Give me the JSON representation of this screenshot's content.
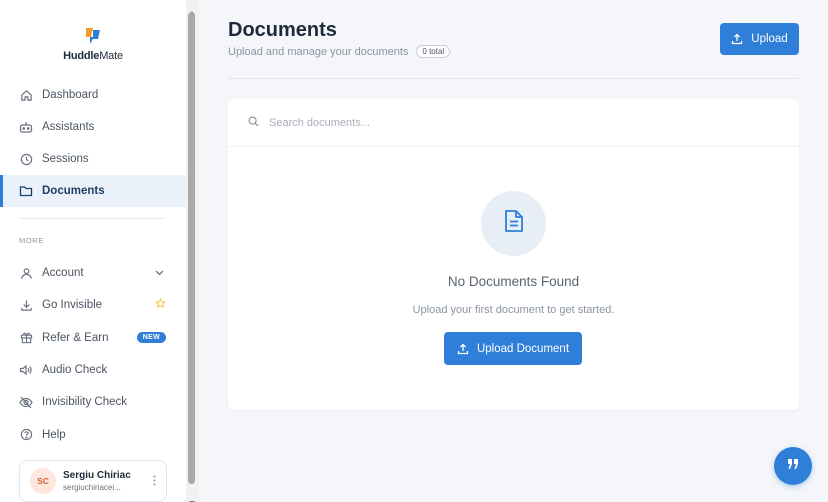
{
  "brand": {
    "name_bold": "Huddle",
    "name_rest": "Mate",
    "logo_colors": [
      "#2f7ed8",
      "#f39c2b"
    ]
  },
  "sidebar": {
    "items": [
      {
        "label": "Dashboard",
        "icon": "home-icon",
        "active": false
      },
      {
        "label": "Assistants",
        "icon": "robot-icon",
        "active": false
      },
      {
        "label": "Sessions",
        "icon": "clock-icon",
        "active": false
      },
      {
        "label": "Documents",
        "icon": "folder-icon",
        "active": true
      }
    ],
    "more_label": "MORE",
    "more_items": [
      {
        "label": "Account",
        "icon": "user-icon",
        "trailing": "chevron-down-icon"
      },
      {
        "label": "Go Invisible",
        "icon": "download-icon",
        "trailing": "star-icon"
      },
      {
        "label": "Refer & Earn",
        "icon": "gift-icon",
        "trailing": "badge",
        "badge": "NEW"
      },
      {
        "label": "Audio Check",
        "icon": "speaker-icon"
      },
      {
        "label": "Invisibility Check",
        "icon": "eye-off-icon"
      },
      {
        "label": "Help",
        "icon": "help-icon"
      }
    ],
    "user": {
      "initials": "SC",
      "name": "Sergiu Chiriac",
      "email": "sergiuchiriacei..."
    }
  },
  "header": {
    "title": "Documents",
    "subtitle": "Upload and manage your documents",
    "count": "0 total",
    "upload_label": "Upload"
  },
  "search": {
    "placeholder": "Search documents..."
  },
  "empty_state": {
    "title": "No Documents Found",
    "subtitle": "Upload your first document to get started.",
    "button_label": "Upload Document"
  },
  "colors": {
    "accent": "#2f7ed8",
    "active_bg": "#eaf1fb",
    "page_bg": "#f4f6f9"
  }
}
